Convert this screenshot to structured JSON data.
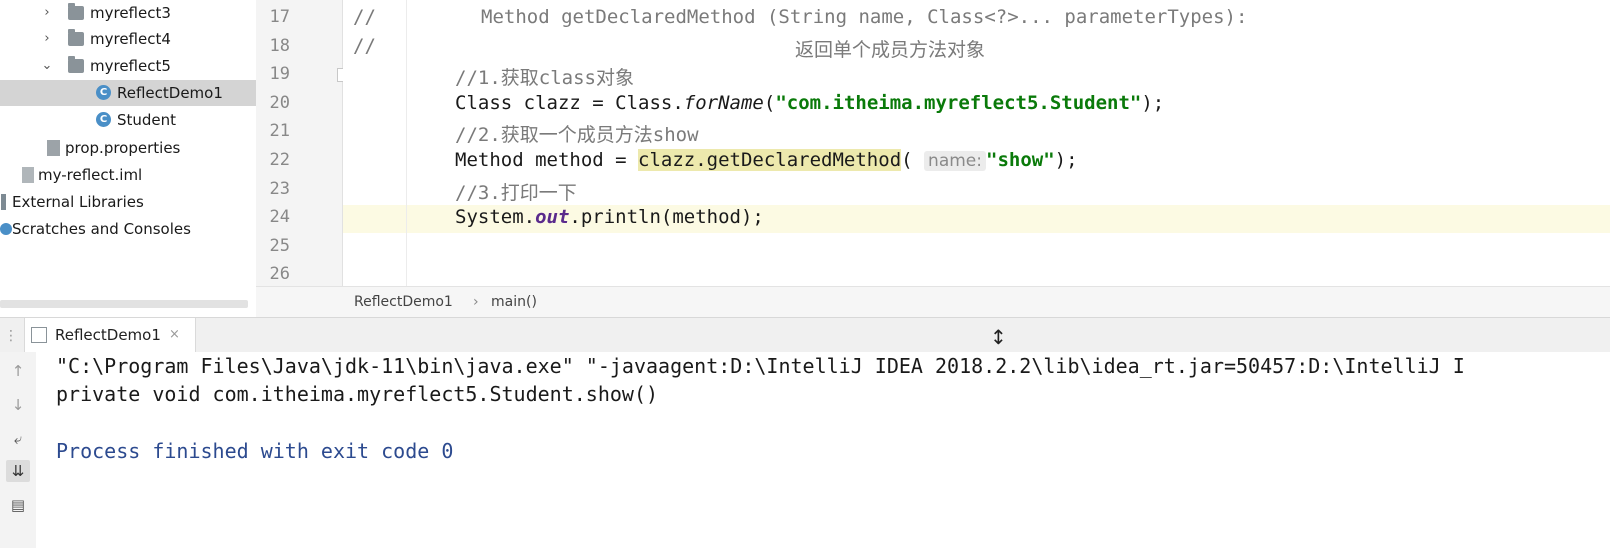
{
  "project_tree": {
    "items": [
      {
        "label": "myreflect3",
        "arrow": "›"
      },
      {
        "label": "myreflect4",
        "arrow": "›"
      },
      {
        "label": "myreflect5",
        "arrow": "⌄"
      },
      {
        "label": "ReflectDemo1",
        "icon": "C"
      },
      {
        "label": "Student",
        "icon": "C"
      },
      {
        "label": "prop.properties"
      },
      {
        "label": "my-reflect.iml"
      },
      {
        "label": "External Libraries"
      },
      {
        "label": "Scratches and Consoles"
      }
    ]
  },
  "editor": {
    "line_numbers": [
      "17",
      "18",
      "19",
      "20",
      "21",
      "22",
      "23",
      "24",
      "25",
      "26"
    ],
    "lines": {
      "l17_prefix": "//",
      "l17_text": "Method getDeclaredMethod (String name, Class<?>... parameterTypes):",
      "l18_prefix": "//",
      "l18_text": "返回单个成员方法对象",
      "l19": "//1.获取class对象",
      "l20_a": "Class clazz = Class.",
      "l20_b": "forName",
      "l20_c": "(",
      "l20_str": "\"com.itheima.myreflect5.Student\"",
      "l20_d": ");",
      "l21": "//2.获取一个成员方法show",
      "l22_a": "Method method = ",
      "l22_hl": "clazz.getDeclaredMethod",
      "l22_b": "(",
      "l22_hint": "name:",
      "l22_str": "\"show\"",
      "l22_c": ");",
      "l23": "//3.打印一下",
      "l24_a": "System.",
      "l24_b": "out",
      "l24_c": ".println(method);"
    }
  },
  "breadcrumb": {
    "file": "ReflectDemo1",
    "sep": "›",
    "method": "main()"
  },
  "run_panel": {
    "tab_label": "ReflectDemo1",
    "tab_close": "×",
    "toolbar_icons": [
      "arrow-up-icon",
      "arrow-down-icon",
      "soft-wrap-icon",
      "scroll-to-end-icon",
      "print-icon"
    ],
    "output": [
      "\"C:\\Program Files\\Java\\jdk-11\\bin\\java.exe\" \"-javaagent:D:\\IntelliJ IDEA 2018.2.2\\lib\\idea_rt.jar=50457:D:\\IntelliJ I",
      "private void com.itheima.myreflect5.Student.show()",
      "",
      "Process finished with exit code 0"
    ]
  },
  "colors": {
    "string": "#0a7a0a",
    "comment": "#7a7a7a",
    "highlight": "#ede9ad",
    "current_line": "#fcfae3",
    "selection": "#d4d4d4"
  }
}
